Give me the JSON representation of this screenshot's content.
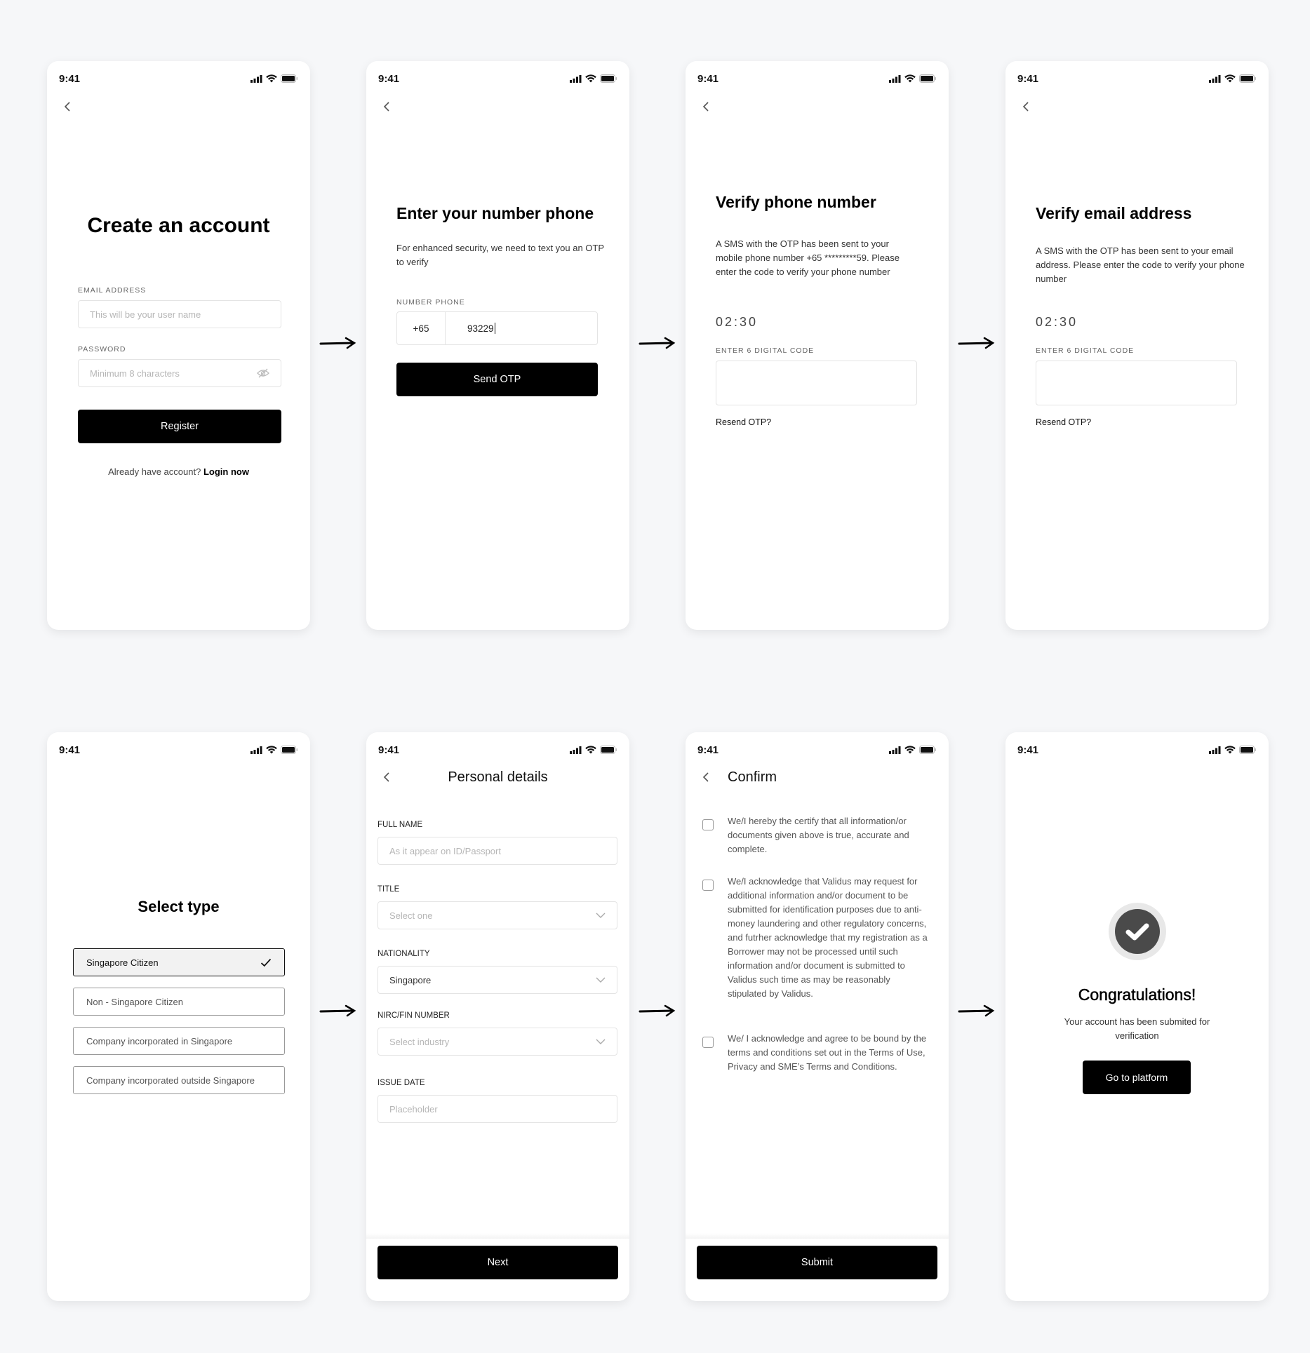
{
  "status_bar": {
    "time": "9:41"
  },
  "screens": {
    "create_account": {
      "title": "Create an account",
      "email_label": "EMAIL ADDRESS",
      "email_placeholder": "This will be your user name",
      "password_label": "PASSWORD",
      "password_placeholder": "Minimum 8 characters",
      "register_button": "Register",
      "already_text": "Already  have account?",
      "login_link": "Login now"
    },
    "enter_phone": {
      "title": "Enter your number phone",
      "description": "For enhanced security, we need to text you an OTP to verify",
      "phone_label": "NUMBER PHONE",
      "country_code": "+65",
      "phone_value": "93229",
      "send_button": "Send OTP"
    },
    "verify_phone": {
      "title": "Verify phone number",
      "description": "A SMS with the OTP has been sent to your mobile phone number +65 *********59. Please enter the code to verify your phone number",
      "timer": "02:30",
      "code_label": "ENTER 6 DIGITAL CODE",
      "resend_link": "Resend OTP?"
    },
    "verify_email": {
      "title": "Verify email address",
      "description": "A SMS with the OTP has been sent to your email address. Please enter the code to verify your phone number",
      "timer": "02:30",
      "code_label": "ENTER 6 DIGITAL CODE",
      "resend_link": "Resend OTP?"
    },
    "select_type": {
      "title": "Select type",
      "options": [
        {
          "label": "Singapore Citizen",
          "selected": true
        },
        {
          "label": "Non - Singapore Citizen",
          "selected": false
        },
        {
          "label": "Company incorporated in Singapore",
          "selected": false
        },
        {
          "label": "Company incorporated outside Singapore",
          "selected": false
        }
      ]
    },
    "personal_details": {
      "title": "Personal details",
      "fields": [
        {
          "label": "FULL NAME",
          "placeholder": "As it appear on ID/Passport",
          "type": "text"
        },
        {
          "label": "TITLE",
          "placeholder": "Select one",
          "type": "select"
        },
        {
          "label": "NATIONALITY",
          "value": "Singapore",
          "type": "select"
        },
        {
          "label": "NIRC/FIN NUMBER",
          "placeholder": "Select industry",
          "type": "select"
        },
        {
          "label": "ISSUE DATE",
          "placeholder": "Placeholder",
          "type": "text"
        }
      ],
      "next_button": "Next"
    },
    "confirm": {
      "title": "Confirm",
      "items": [
        {
          "text": "We/I hereby the certify that all information/or documents given above is true, accurate and complete.",
          "checked": false
        },
        {
          "text": "We/I acknowledge that Validus may request for additional information and/or document to be submitted for identification purposes due to anti-money laundering and other regulatory concerns, and futrher acknowledge that my registration as a Borrower may not be processed until such information and/or document is submitted to Validus such time as may be reasonably stipulated by Validus.",
          "checked": false
        },
        {
          "text": "We/ I acknowledge and agree to be bound by the terms and conditions set out in the Terms of Use, Privacy and SME’s Terms and Conditions.",
          "checked": false
        }
      ],
      "submit_button": "Submit"
    },
    "success": {
      "title": "Congratulations!",
      "message": "Your account has been submited for verification",
      "button": "Go to platform"
    }
  }
}
